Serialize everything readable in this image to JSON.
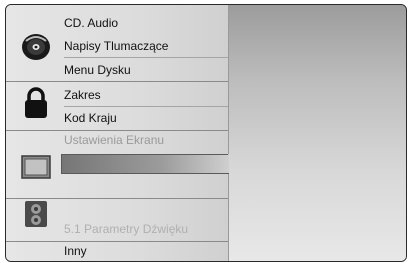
{
  "menu": {
    "items": [
      {
        "label": "CD. Audio"
      },
      {
        "label": "Napisy Tlumaczące"
      },
      {
        "label": "Menu Dysku"
      },
      {
        "label": "Zakres"
      },
      {
        "label": "Kod Kraju"
      },
      {
        "label": "Ustawienia Ekranu"
      },
      {
        "label": "5.1 Parametry Dźwięku"
      },
      {
        "label": "Inny"
      }
    ],
    "selected": "Ustawienia Ekranu"
  },
  "icons": [
    "disc-icon",
    "lock-icon",
    "tv-screen-icon",
    "speaker-icon"
  ]
}
